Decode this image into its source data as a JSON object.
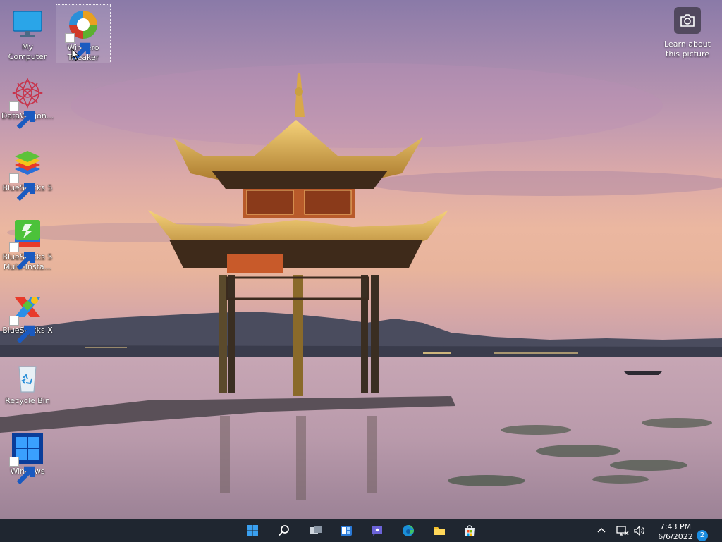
{
  "desktop": {
    "icons": [
      {
        "label": "My Computer",
        "icon": "monitor-icon"
      },
      {
        "label": "Winaero Tweaker",
        "icon": "winaero-tweaker-icon"
      },
      {
        "label": "DataWagon...",
        "icon": "datawagon-icon"
      },
      {
        "label": "BlueStacks 5",
        "icon": "bluestacks-icon"
      },
      {
        "label": "BlueStacks 5 Multi-Insta...",
        "icon": "bluestacks-multi-instance-icon"
      },
      {
        "label": "BlueStacks X",
        "icon": "bluestacks-x-icon"
      },
      {
        "label": "Recycle Bin",
        "icon": "recycle-bin-icon"
      },
      {
        "label": "Windows",
        "icon": "windows-logo-icon"
      }
    ],
    "learn_about": "Learn about this picture"
  },
  "taskbar": {
    "buttons": [
      "start-icon",
      "search-icon",
      "task-view-icon",
      "widgets-icon",
      "teams-chat-icon",
      "edge-icon",
      "file-explorer-icon",
      "microsoft-store-icon"
    ],
    "tray_icons": [
      "chevron-up-icon",
      "network-icon",
      "volume-icon"
    ],
    "time": "7:43 PM",
    "date": "6/6/2022",
    "notification_count": "2"
  },
  "colors": {
    "taskbar_bg": "#1f2630",
    "accent": "#1a8ce0"
  }
}
